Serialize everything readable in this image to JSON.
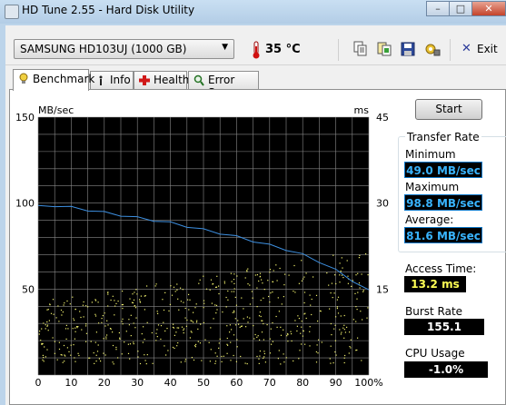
{
  "window": {
    "title": "HD Tune 2.55 - Hard Disk Utility",
    "buttons": {
      "minimize": "–",
      "maximize": "□",
      "close": "✕"
    }
  },
  "toolbar": {
    "drive": "SAMSUNG HD103UJ (1000 GB)",
    "temperature": "35 °C",
    "exit_label": "Exit",
    "icons": [
      "copy-info-icon",
      "copy-screen-icon",
      "save-icon",
      "options-icon",
      "exit-icon"
    ]
  },
  "tabs": [
    {
      "label": "Benchmark",
      "icon": "benchmark-icon",
      "active": true
    },
    {
      "label": "Info",
      "icon": "info-icon",
      "active": false
    },
    {
      "label": "Health",
      "icon": "health-icon",
      "active": false
    },
    {
      "label": "Error Scan",
      "icon": "error-scan-icon",
      "active": false
    }
  ],
  "benchmark": {
    "start_label": "Start",
    "transfer_rate_title": "Transfer Rate",
    "minimum_label": "Minimum",
    "minimum_value": "49.0 MB/sec",
    "maximum_label": "Maximum",
    "maximum_value": "98.8 MB/sec",
    "average_label": "Average:",
    "average_value": "81.6 MB/sec",
    "access_time_label": "Access Time:",
    "access_time_value": "13.2 ms",
    "burst_rate_label": "Burst Rate",
    "burst_rate_value": "155.1 MB/sec",
    "cpu_usage_label": "CPU Usage",
    "cpu_usage_value": "-1.0%"
  },
  "chart_data": {
    "type": "line",
    "ylabel_left": "MB/sec",
    "ylabel_right": "ms",
    "left_ticks": [
      "150",
      "100",
      "50"
    ],
    "right_ticks": [
      "45",
      "30",
      "15"
    ],
    "x_ticks": [
      "0",
      "10",
      "20",
      "30",
      "40",
      "50",
      "60",
      "70",
      "80",
      "90",
      "100%"
    ],
    "ylim_left": [
      0,
      150
    ],
    "ylim_right": [
      0,
      45
    ],
    "xlim": [
      0,
      100
    ],
    "grid": true,
    "series": [
      {
        "color": "#3d8fe0",
        "x": [
          0,
          5,
          10,
          15,
          20,
          25,
          30,
          35,
          40,
          45,
          50,
          55,
          60,
          65,
          70,
          75,
          80,
          85,
          90,
          95,
          100
        ],
        "values": [
          98,
          98.5,
          97.5,
          96,
          94.5,
          93,
          91.5,
          90,
          88.5,
          86.5,
          84.5,
          82.5,
          80.5,
          78,
          75.5,
          73,
          70,
          66,
          61,
          55,
          49
        ]
      }
    ],
    "access_time": {
      "color": "#f2f26e",
      "range_ms": [
        2,
        22
      ]
    }
  }
}
